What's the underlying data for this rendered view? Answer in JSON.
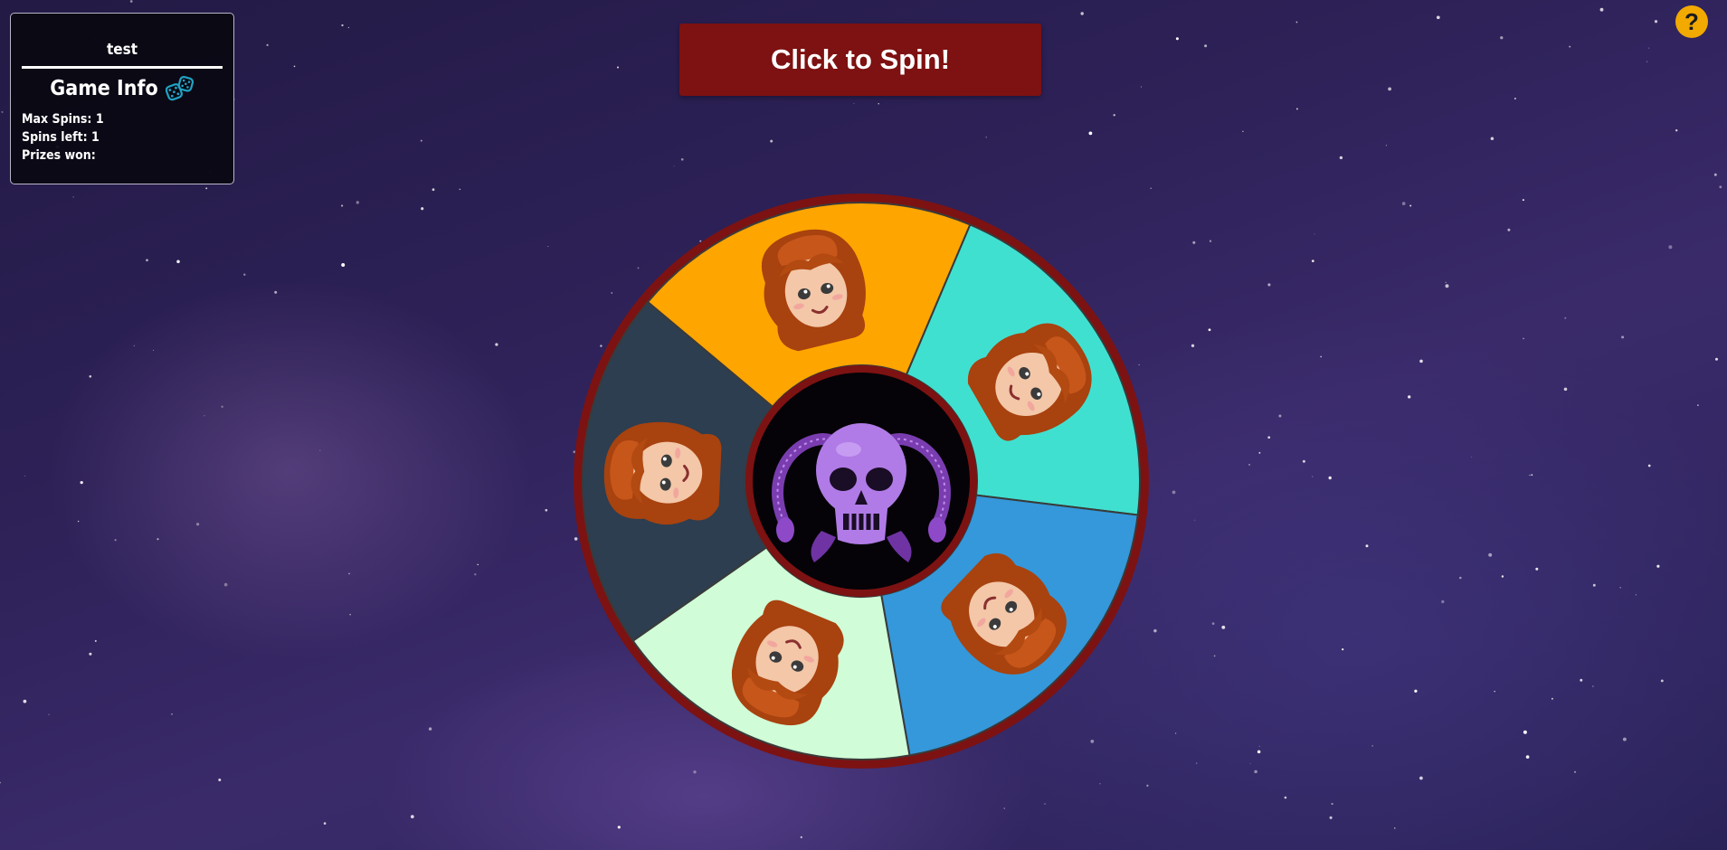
{
  "info_panel": {
    "username": "test",
    "title": "Game Info",
    "max_spins_label": "Max Spins: 1",
    "spins_left_label": "Spins left: 1",
    "prizes_won_label": "Prizes won:"
  },
  "spin_button": {
    "label": "Click to Spin!"
  },
  "help_button": {
    "label": "?"
  },
  "wheel": {
    "segments": [
      {
        "name": "segment-orange",
        "color": "#ffa500",
        "icon": "celebrating-character-icon"
      },
      {
        "name": "segment-turquoise",
        "color": "#40e0d0",
        "icon": "worried-character-icon"
      },
      {
        "name": "segment-blue",
        "color": "#3498db",
        "icon": "blushing-character-icon"
      },
      {
        "name": "segment-mint",
        "color": "#d0fdd7",
        "icon": "crying-character-icon"
      },
      {
        "name": "segment-dark-slate",
        "color": "#2c3e50",
        "icon": "cards-character-icon"
      }
    ],
    "rim_color": "#7d1212",
    "hub_icon": "purple-skull-icon"
  },
  "colors": {
    "panel_bg": "#0a0812",
    "button_bg": "#7e1111",
    "help_bg": "#f2a900",
    "dice_color": "#1fa3c4"
  }
}
